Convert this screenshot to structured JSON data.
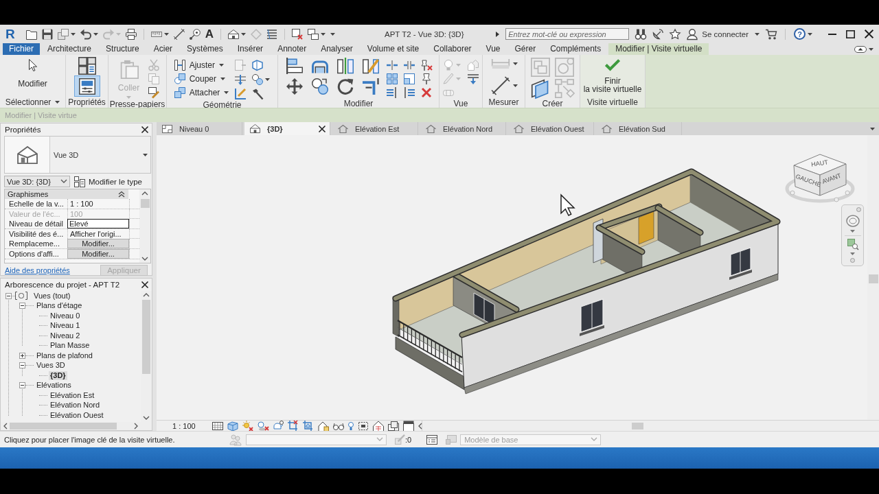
{
  "quick_access": {
    "app_logo": "R",
    "text_tool": "A"
  },
  "title_bar": {
    "title": "APT T2 - Vue 3D: {3D}",
    "search": {
      "placeholder": "Entrez mot-clé ou expression"
    },
    "sign_in": "Se connecter",
    "help": "?"
  },
  "ribbon_tabs": [
    {
      "label": "Fichier",
      "kind": "application",
      "selected": false
    },
    {
      "label": "Architecture",
      "kind": "normal",
      "selected": false
    },
    {
      "label": "Structure",
      "kind": "normal",
      "selected": false
    },
    {
      "label": "Acier",
      "kind": "normal",
      "selected": false
    },
    {
      "label": "Systèmes",
      "kind": "normal",
      "selected": false
    },
    {
      "label": "Insérer",
      "kind": "normal",
      "selected": false
    },
    {
      "label": "Annoter",
      "kind": "normal",
      "selected": false
    },
    {
      "label": "Analyser",
      "kind": "normal",
      "selected": false
    },
    {
      "label": "Volume et site",
      "kind": "normal",
      "selected": false
    },
    {
      "label": "Collaborer",
      "kind": "normal",
      "selected": false
    },
    {
      "label": "Vue",
      "kind": "normal",
      "selected": false
    },
    {
      "label": "Gérer",
      "kind": "normal",
      "selected": false
    },
    {
      "label": "Compléments",
      "kind": "normal",
      "selected": false
    },
    {
      "label": "Modifier | Visite virtuelle",
      "kind": "contextual",
      "selected": true
    }
  ],
  "ribbon_panels": [
    {
      "kind": "select",
      "label": "Sélectionner",
      "buttons": [
        {
          "label": "Modifier",
          "disabled": false
        }
      ]
    },
    {
      "kind": "properties",
      "label": "Propriétés",
      "properties_button_on": true
    },
    {
      "kind": "clipboard",
      "label": "Presse-papiers",
      "buttons": [
        {
          "label": "Coller",
          "disabled": true
        }
      ]
    },
    {
      "kind": "geometry",
      "label": "Géométrie",
      "buttons": [
        {
          "label": "Ajuster",
          "disabled": false
        },
        {
          "label": "Couper",
          "disabled": false
        },
        {
          "label": "Attacher",
          "disabled": false
        }
      ]
    },
    {
      "kind": "modify",
      "label": "Modifier"
    },
    {
      "kind": "view",
      "label": "Vue"
    },
    {
      "kind": "measure",
      "label": "Mesurer"
    },
    {
      "kind": "create",
      "label": "Créer"
    },
    {
      "kind": "walkthrough",
      "label": "Visite virtuelle",
      "buttons": [
        {
          "label_lines": [
            "Finir",
            "la visite virtuelle"
          ],
          "disabled": false
        }
      ]
    }
  ],
  "options_bar": {
    "label": "Modifier | Visite virtue"
  },
  "properties": {
    "title": "Propriétés",
    "type_name": "Vue 3D",
    "instance": "Vue 3D: {3D}",
    "edit_type": "Modifier le type",
    "group": "Graphismes",
    "rows": [
      {
        "name": "Echelle de la v...",
        "value": "1 : 100",
        "kind": "text",
        "disabled": false
      },
      {
        "name": "Valeur de l'éc...",
        "value": "100",
        "kind": "text",
        "disabled": true
      },
      {
        "name": "Niveau de détail",
        "value": "Elevé",
        "kind": "field",
        "disabled": false
      },
      {
        "name": "Visibilité des é...",
        "value": "Afficher l'origi...",
        "kind": "text",
        "disabled": false
      },
      {
        "name": "Remplaceme...",
        "value": "Modifier...",
        "kind": "button",
        "disabled": false
      },
      {
        "name": "Options d'affi...",
        "value": "Modifier...",
        "kind": "button",
        "disabled": false
      }
    ],
    "help_link": "Aide des propriétés",
    "apply": {
      "label": "Appliquer",
      "disabled": true
    }
  },
  "view_tabs": [
    {
      "label": "Niveau 0",
      "kind": "plan",
      "selected": false
    },
    {
      "label": "{3D}",
      "kind": "perspective",
      "selected": true
    },
    {
      "label": "Elévation Est",
      "kind": "elevation",
      "selected": false
    },
    {
      "label": "Elévation Nord",
      "kind": "elevation",
      "selected": false
    },
    {
      "label": "Elévation Ouest",
      "kind": "elevation",
      "selected": false
    },
    {
      "label": "Elévation Sud",
      "kind": "elevation",
      "selected": false
    }
  ],
  "viewport": {
    "viewcube_faces": [
      "HAUT",
      "GAUCHE",
      "AVANT"
    ]
  },
  "project_browser": {
    "title": "Arborescence du projet - APT T2",
    "tree": [
      {
        "label": "Vues (tout)",
        "expanded": true,
        "selected": false,
        "children": [
          {
            "label": "Plans d'étage",
            "expanded": true,
            "selected": false,
            "children": [
              {
                "label": "Niveau 0",
                "selected": false
              },
              {
                "label": "Niveau 1",
                "selected": false
              },
              {
                "label": "Niveau 2",
                "selected": false
              },
              {
                "label": "Plan Masse",
                "selected": false
              }
            ]
          },
          {
            "label": "Plans de plafond",
            "expanded": false,
            "selected": false
          },
          {
            "label": "Vues 3D",
            "expanded": true,
            "selected": false,
            "children": [
              {
                "label": "{3D}",
                "selected": true
              }
            ]
          },
          {
            "label": "Elévations",
            "expanded": true,
            "selected": false,
            "children": [
              {
                "label": "Elévation Est",
                "selected": false
              },
              {
                "label": "Elévation Nord",
                "selected": false
              },
              {
                "label": "Elévation Ouest",
                "selected": false
              }
            ]
          }
        ]
      }
    ]
  },
  "view_control_bar": {
    "scale": "1 : 100"
  },
  "status_bar": {
    "message": "Cliquez pour placer l'image clé de la visite virtuelle.",
    "count": ":0",
    "model": {
      "value": "Modèle de base",
      "disabled": true
    }
  }
}
